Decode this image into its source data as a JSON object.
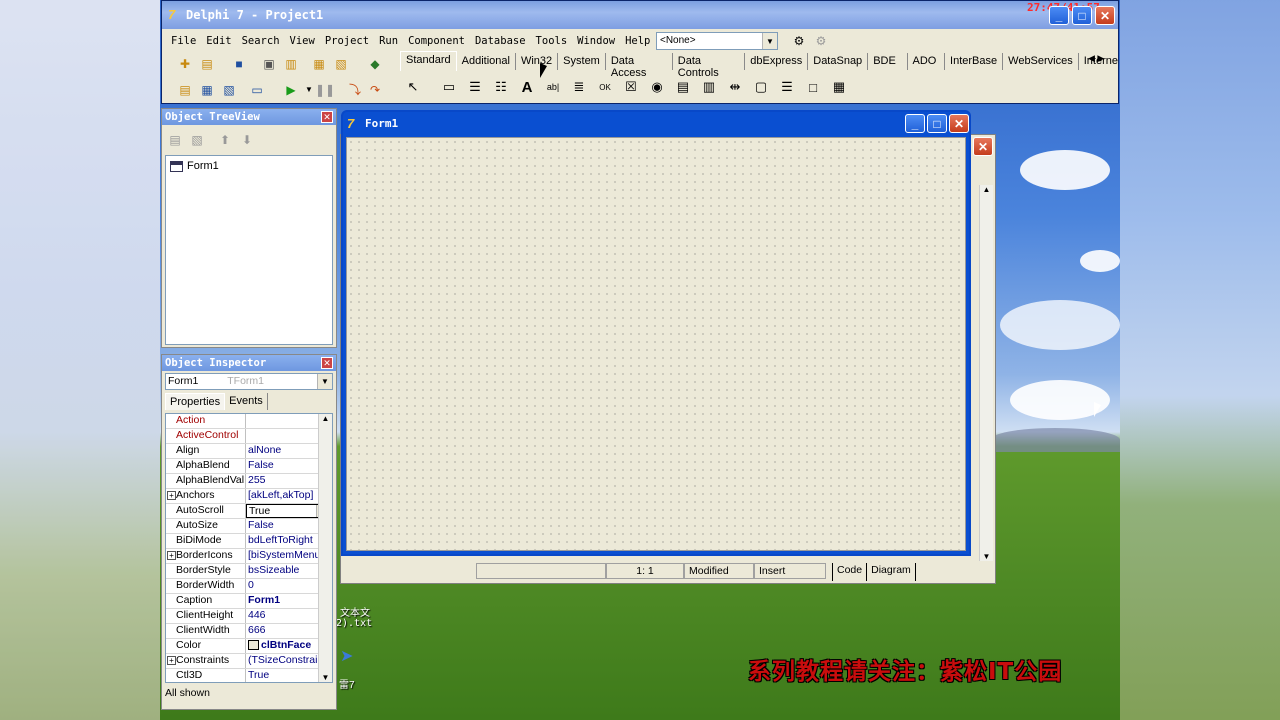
{
  "window": {
    "title": "Delphi 7 - Project1",
    "clock": "27:47/41:57"
  },
  "menu": [
    "File",
    "Edit",
    "Search",
    "View",
    "Project",
    "Run",
    "Component",
    "Database",
    "Tools",
    "Window",
    "Help"
  ],
  "toolbar": {
    "combo_value": "<None>"
  },
  "palette_tabs": [
    "Standard",
    "Additional",
    "Win32",
    "System",
    "Data Access",
    "Data Controls",
    "dbExpress",
    "DataSnap",
    "BDE",
    "ADO",
    "InterBase",
    "WebServices",
    "InternetE"
  ],
  "palette_icons": [
    "pointer-icon",
    "frames-icon",
    "main-menu-icon",
    "popup-menu-icon",
    "label-icon",
    "edit-icon",
    "memo-icon",
    "button-icon",
    "checkbox-icon",
    "radio-button-icon",
    "listbox-icon",
    "combobox-icon",
    "scrollbar-icon",
    "groupbox-icon",
    "radiogroup-icon",
    "panel-icon",
    "actionlist-icon"
  ],
  "tree_view": {
    "title": "Object TreeView",
    "items": [
      "Form1"
    ]
  },
  "object_inspector": {
    "title": "Object Inspector",
    "selected_object": "Form1",
    "selected_type": "TForm1",
    "tabs": [
      "Properties",
      "Events"
    ],
    "properties": [
      {
        "name": "Action",
        "value": ""
      },
      {
        "name": "ActiveControl",
        "value": ""
      },
      {
        "name": "Align",
        "value": "alNone"
      },
      {
        "name": "AlphaBlend",
        "value": "False"
      },
      {
        "name": "AlphaBlendVal",
        "value": "255"
      },
      {
        "name": "Anchors",
        "value": "[akLeft,akTop]"
      },
      {
        "name": "AutoScroll",
        "value": "True"
      },
      {
        "name": "AutoSize",
        "value": "False"
      },
      {
        "name": "BiDiMode",
        "value": "bdLeftToRight"
      },
      {
        "name": "BorderIcons",
        "value": "[biSystemMenu,"
      },
      {
        "name": "BorderStyle",
        "value": "bsSizeable"
      },
      {
        "name": "BorderWidth",
        "value": "0"
      },
      {
        "name": "Caption",
        "value": "Form1"
      },
      {
        "name": "ClientHeight",
        "value": "446"
      },
      {
        "name": "ClientWidth",
        "value": "666"
      },
      {
        "name": "Color",
        "value": "clBtnFace"
      },
      {
        "name": "Constraints",
        "value": "(TSizeConstrain"
      },
      {
        "name": "Ctl3D",
        "value": "True"
      }
    ],
    "status": "All shown"
  },
  "form": {
    "title": "Form1"
  },
  "editor_status": {
    "position": "1:   1",
    "modified": "Modified",
    "mode": "Insert",
    "tab_code": "Code",
    "tab_diagram": "Diagram"
  },
  "desktop": {
    "file_label_1": "文本文",
    "file_label_2": "2).txt",
    "app_label": "雷7",
    "watermark": "系列教程请关注：紫松IT公园"
  }
}
